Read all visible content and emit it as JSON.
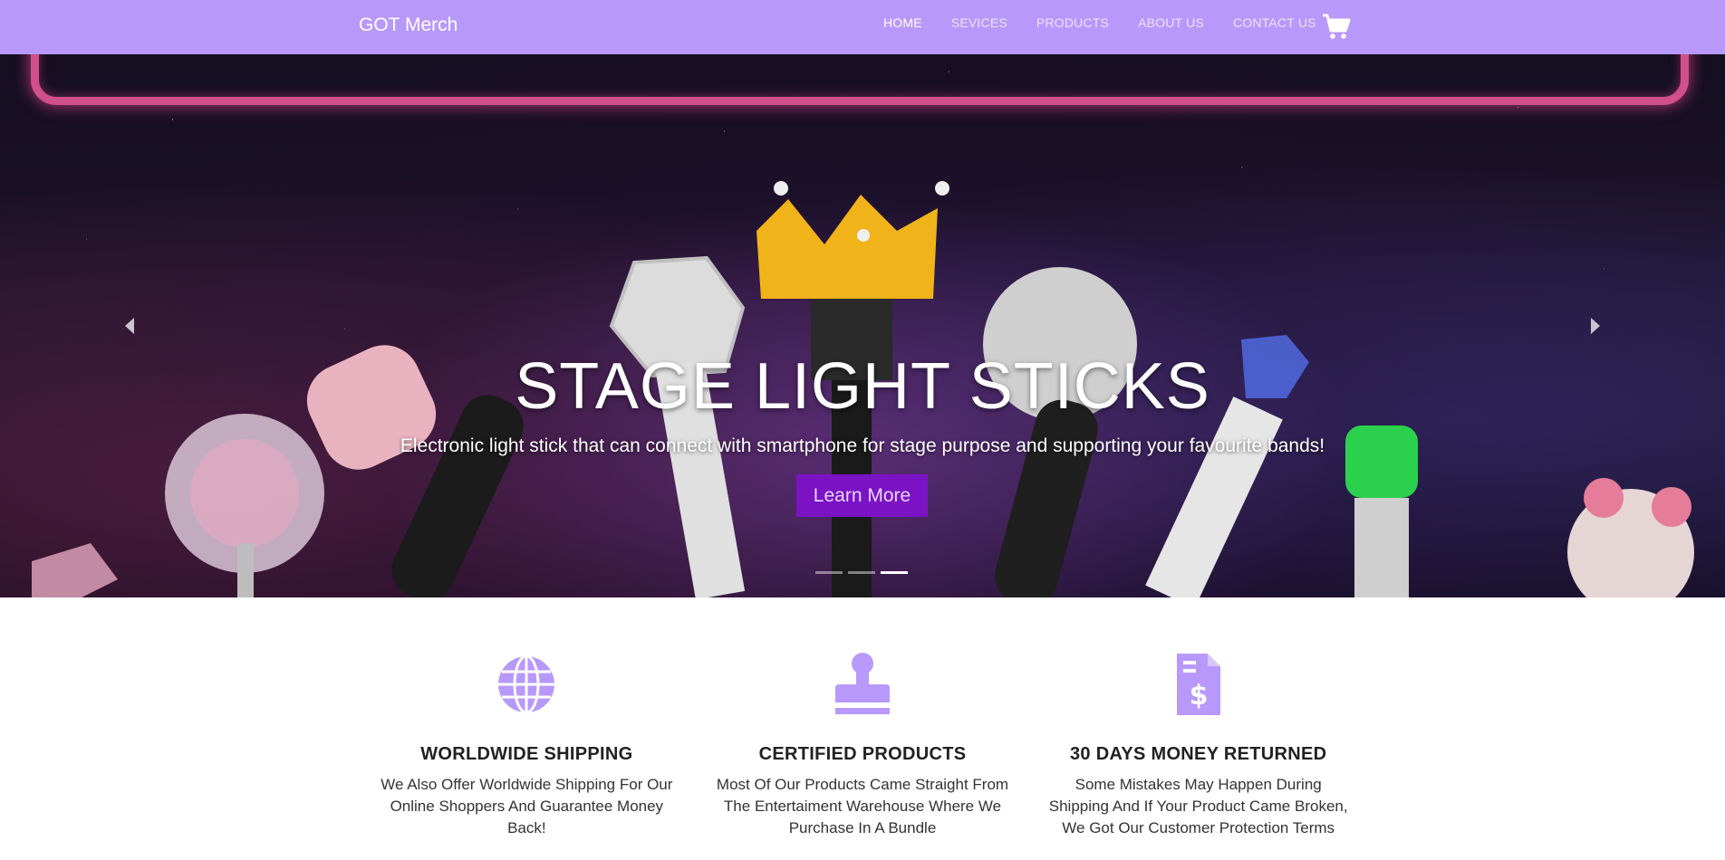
{
  "navbar": {
    "brand": "GOT Merch",
    "links": [
      "HOME",
      "SEVICES",
      "PRODUCTS",
      "ABOUT US",
      "CONTACT US"
    ],
    "active_link": "HOME",
    "cart_icon": "shopping-cart-icon"
  },
  "hero": {
    "title": "STAGE LIGHT STICKS",
    "subtitle": "Electronic light stick that can connect with smartphone for stage purpose and supporting your favourite bands!",
    "button_label": "Learn More",
    "slide_count": 3,
    "active_slide": 3,
    "prev_icon": "chevron-left-icon",
    "next_icon": "chevron-right-icon"
  },
  "features": [
    {
      "icon": "globe-icon",
      "title": "WORLDWIDE SHIPPING",
      "text": "We Also Offer Worldwide Shipping For Our Online Shoppers And Guarantee Money Back!"
    },
    {
      "icon": "stamp-icon",
      "title": "CERTIFIED PRODUCTS",
      "text": "Most Of Our Products Came Straight From The Entertaiment Warehouse Where We Purchase In A Bundle"
    },
    {
      "icon": "invoice-dollar-icon",
      "title": "30 DAYS MONEY RETURNED",
      "text": "Some Mistakes May Happen During Shipping And If Your Product Came Broken, We Got Our Customer Protection Terms"
    }
  ],
  "colors": {
    "navbar": "#b899fb",
    "accent_button": "#7b13c4",
    "feature_icon": "#b899fb"
  }
}
